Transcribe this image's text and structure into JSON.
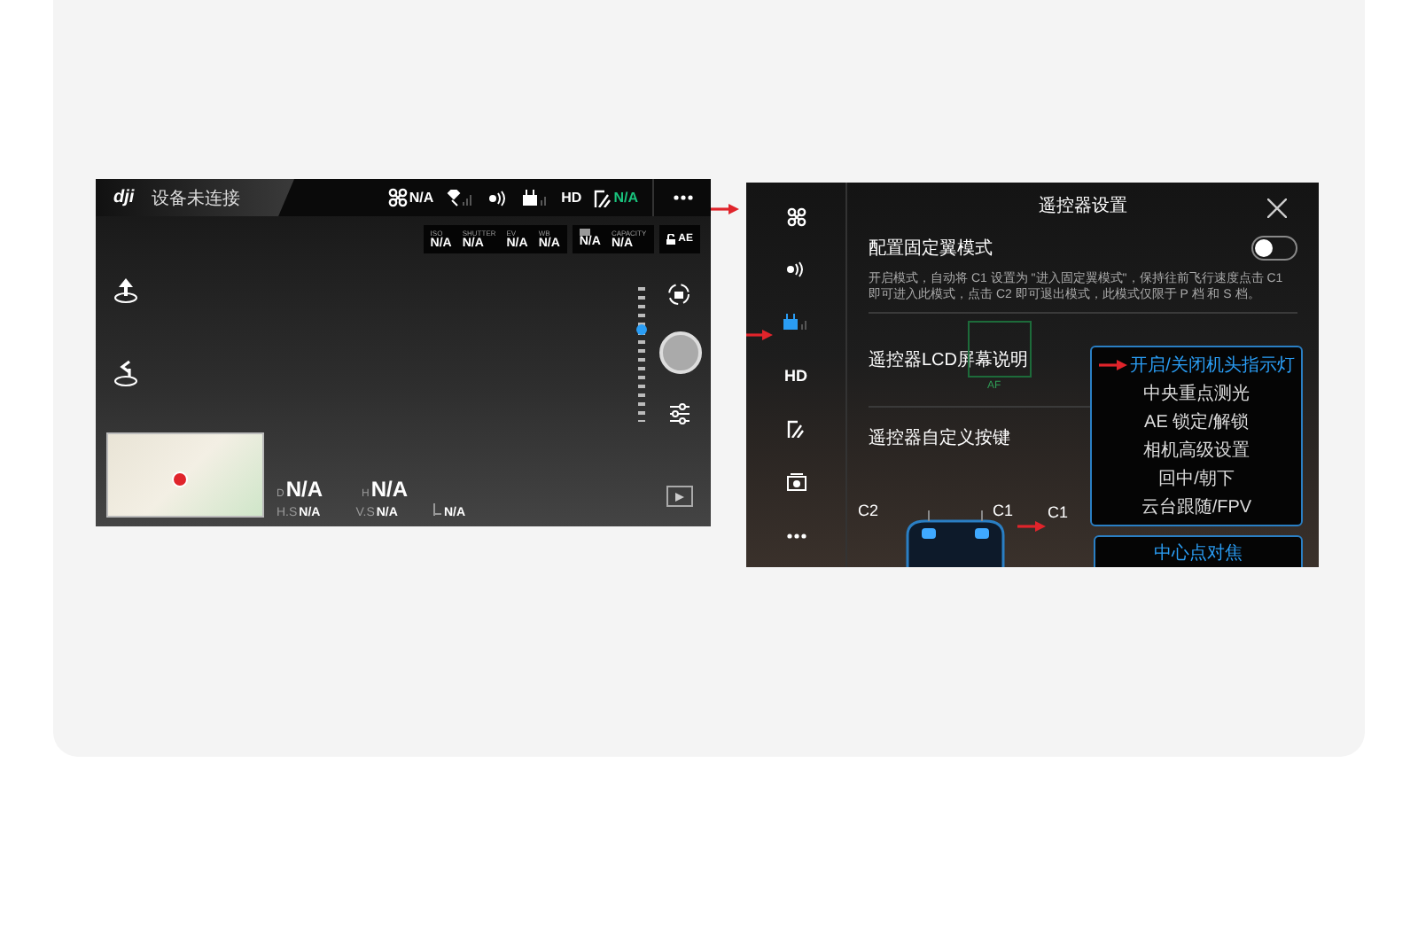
{
  "flight_view": {
    "logo": "dji",
    "status": "设备未连接",
    "indicators": [
      {
        "kind": "drone",
        "text": "N/A",
        "color": "#ffffff"
      },
      {
        "kind": "satellite"
      },
      {
        "kind": "signal"
      },
      {
        "kind": "remote"
      },
      {
        "kind": "hd",
        "label": "HD"
      },
      {
        "kind": "vision",
        "text": "N/A",
        "color": "#19c37d"
      }
    ],
    "camera_params": [
      {
        "label": "ISO",
        "value": "N/A"
      },
      {
        "label": "SHUTTER",
        "value": "N/A"
      },
      {
        "label": "EV",
        "value": "N/A"
      },
      {
        "label": "WB",
        "value": "N/A"
      }
    ],
    "storage_params": [
      {
        "kind": "icon",
        "value": "N/A"
      },
      {
        "kind": "text",
        "label": "CAPACITY",
        "value": "N/A"
      }
    ],
    "ae_lock": "AE",
    "exposure": {
      "level": 0.73
    },
    "telemetry_primary": [
      {
        "label": "D",
        "value": "N/A"
      },
      {
        "label": "H",
        "value": "N/A"
      }
    ],
    "telemetry_secondary": [
      {
        "kind": "text",
        "label": "H.S",
        "value": "N/A"
      },
      {
        "kind": "text",
        "label": "V.S",
        "value": "N/A"
      },
      {
        "kind": "icon",
        "value": "N/A"
      }
    ]
  },
  "settings_view": {
    "sidebar": [
      {
        "kind": "drone",
        "selected": false
      },
      {
        "kind": "signal",
        "selected": false
      },
      {
        "kind": "remote",
        "selected": true
      },
      {
        "kind": "hd",
        "label": "HD",
        "selected": false
      },
      {
        "kind": "vision",
        "selected": false
      },
      {
        "kind": "camera",
        "selected": false
      },
      {
        "kind": "more",
        "selected": false
      }
    ],
    "title": "遥控器设置",
    "fixed_wing": {
      "label": "配置固定翼模式",
      "on": false
    },
    "description": "开启模式，自动将 C1 设置为 \"进入固定翼模式\"，保持往前飞行速度点击 C1 即可进入此模式，点击 C2 即可退出模式，此模式仅限于 P 档 和 S 档。",
    "lcd_label": "遥控器LCD屏幕说明",
    "lcd_focus": "AF",
    "custom_keys_label": "遥控器自定义按键",
    "button_labels": [
      "C2",
      "C1"
    ],
    "annotation": "C1",
    "options": [
      {
        "label": "开启/关闭机头指示灯",
        "selected": true
      },
      {
        "label": "中央重点测光",
        "selected": false
      },
      {
        "label": "AE 锁定/解锁",
        "selected": false
      },
      {
        "label": "相机高级设置",
        "selected": false
      },
      {
        "label": "回中/朝下",
        "selected": false
      },
      {
        "label": "云台跟随/FPV",
        "selected": false
      }
    ],
    "next_option": "中心点对焦"
  }
}
